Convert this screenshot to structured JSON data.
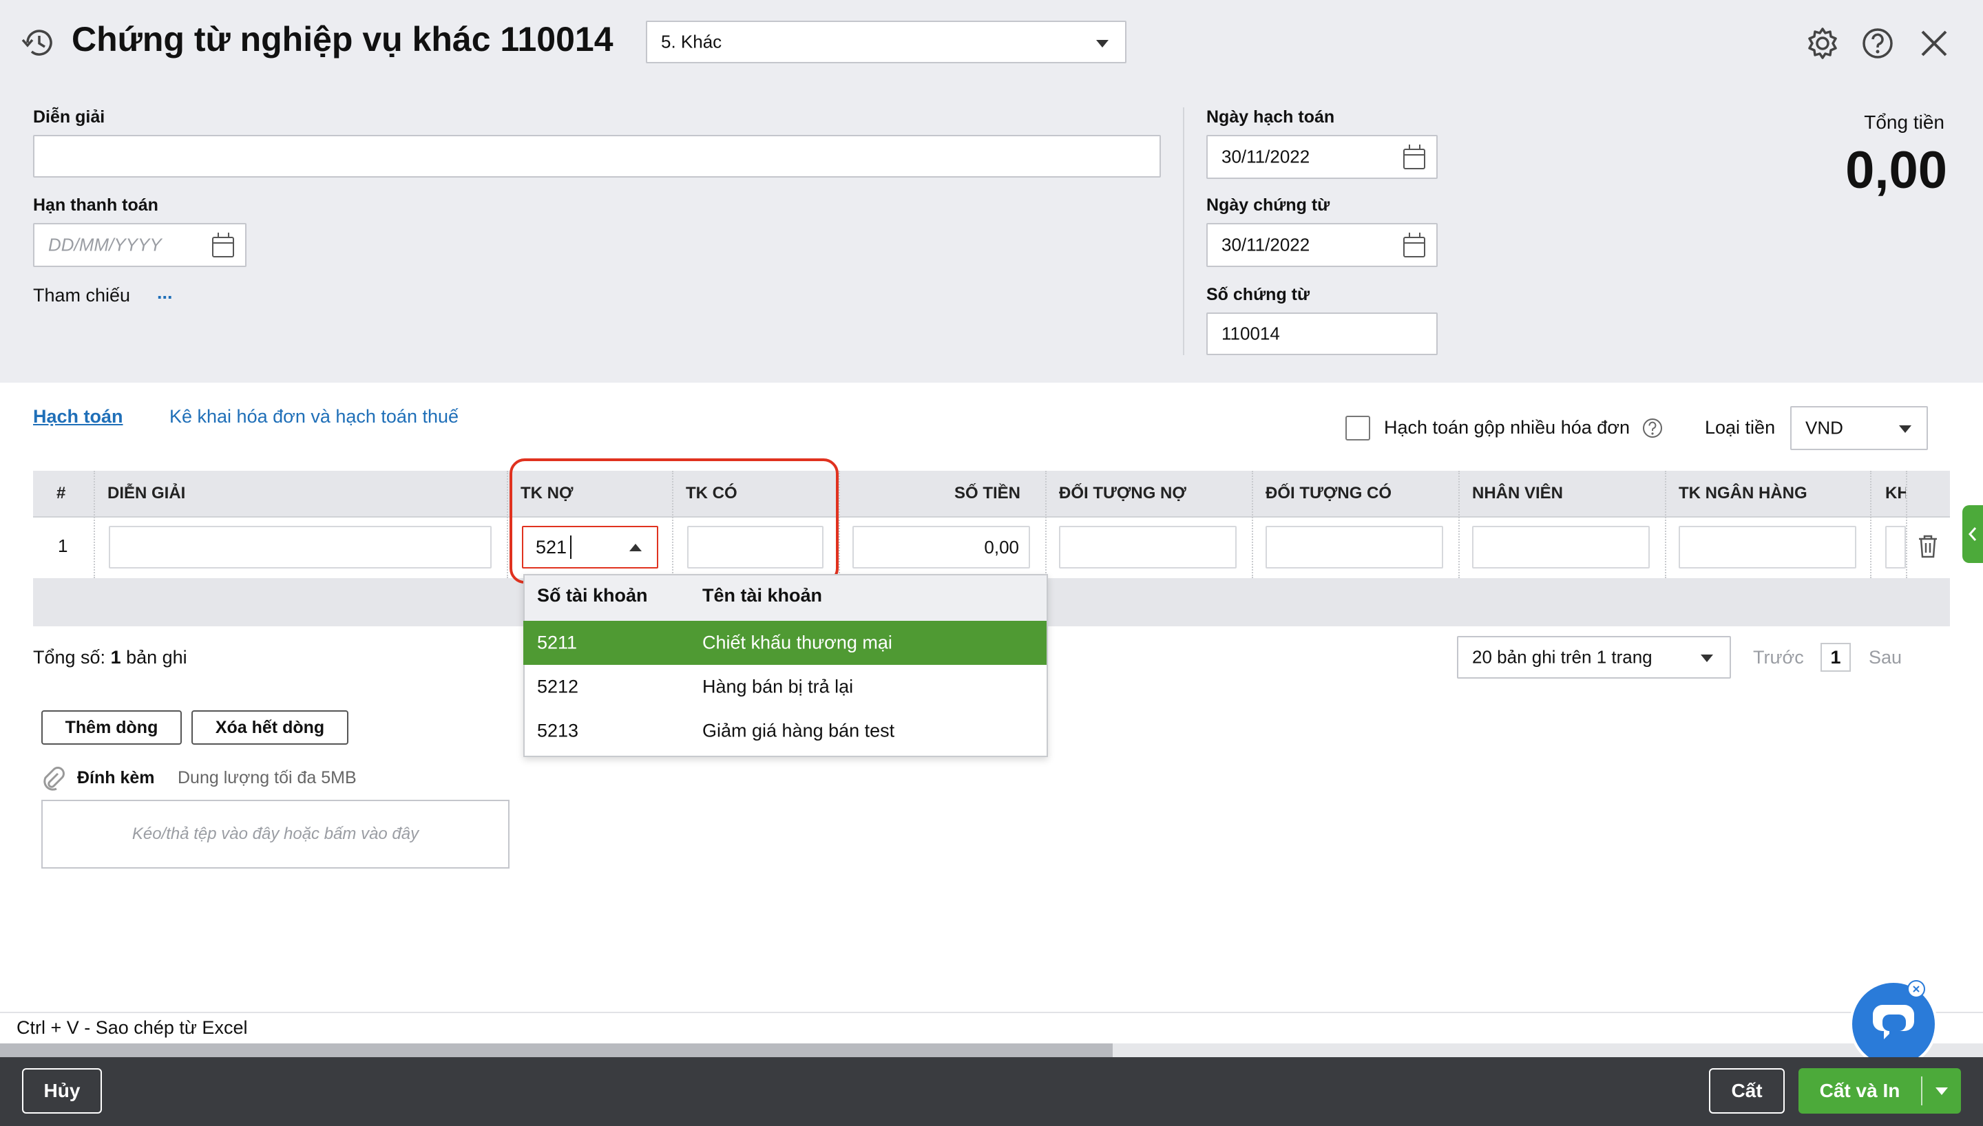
{
  "header": {
    "title": "Chứng từ nghiệp vụ khác 110014",
    "type_select": "5. Khác",
    "icons": [
      "history-icon",
      "gear-icon",
      "help-icon",
      "close-icon"
    ]
  },
  "form": {
    "dien_giai_label": "Diễn giải",
    "dien_giai_value": "",
    "han_thanh_toan_label": "Hạn thanh toán",
    "han_thanh_toan_placeholder": "DD/MM/YYYY",
    "tham_chieu_label": "Tham chiếu",
    "tham_chieu_more": "...",
    "ngay_hach_toan_label": "Ngày hạch toán",
    "ngay_hach_toan_value": "30/11/2022",
    "ngay_chung_tu_label": "Ngày chứng từ",
    "ngay_chung_tu_value": "30/11/2022",
    "so_chung_tu_label": "Số chứng từ",
    "so_chung_tu_value": "110014",
    "tong_tien_label": "Tổng tiền",
    "tong_tien_value": "0,00"
  },
  "tabs": [
    {
      "label": "Hạch toán",
      "active": true
    },
    {
      "label": "Kê khai hóa đơn và hạch toán thuế",
      "active": false
    }
  ],
  "options": {
    "gop_label": "Hạch toán gộp nhiều hóa đơn",
    "gop_checked": false,
    "loai_tien_label": "Loại tiền",
    "loai_tien_value": "VND"
  },
  "table": {
    "columns": [
      "#",
      "DIỄN GIẢI",
      "TK NỢ",
      "TK CÓ",
      "SỐ TIỀN",
      "ĐỐI TƯỢNG NỢ",
      "ĐỐI TƯỢNG CÓ",
      "NHÂN VIÊN",
      "TK NGÂN HÀNG",
      "KH"
    ],
    "rows": [
      {
        "index": "1",
        "dien_giai": "",
        "tk_no": "521",
        "tk_co": "",
        "so_tien": "0,00"
      }
    ]
  },
  "dropdown": {
    "headers": [
      "Số tài khoản",
      "Tên tài khoản"
    ],
    "items": [
      {
        "code": "5211",
        "name": "Chiết khấu thương mại",
        "selected": true
      },
      {
        "code": "5212",
        "name": "Hàng bán bị trả lại",
        "selected": false
      },
      {
        "code": "5213",
        "name": "Giảm giá hàng bán test",
        "selected": false
      }
    ]
  },
  "summary": {
    "prefix": "Tổng số: ",
    "count": "1",
    "suffix": " bản ghi"
  },
  "pagination": {
    "page_size": "20 bản ghi trên 1 trang",
    "prev": "Trước",
    "page": "1",
    "next": "Sau"
  },
  "actions": {
    "add_row": "Thêm dòng",
    "delete_rows": "Xóa hết dòng"
  },
  "attach": {
    "label": "Đính kèm",
    "limit": "Dung lượng tối đa 5MB",
    "dropzone": "Kéo/thả tệp vào đây hoặc bấm vào đây"
  },
  "hint": "Ctrl + V - Sao chép từ Excel",
  "footer": {
    "cancel": "Hủy",
    "save": "Cất",
    "save_print": "Cất và In"
  },
  "colors": {
    "accent": "#1f6fb8",
    "selected": "#4f9a33",
    "primary_button": "#4caa3a",
    "highlight": "#e0321f",
    "footer_bg": "#3a3c40",
    "chat": "#2a7bd9"
  }
}
